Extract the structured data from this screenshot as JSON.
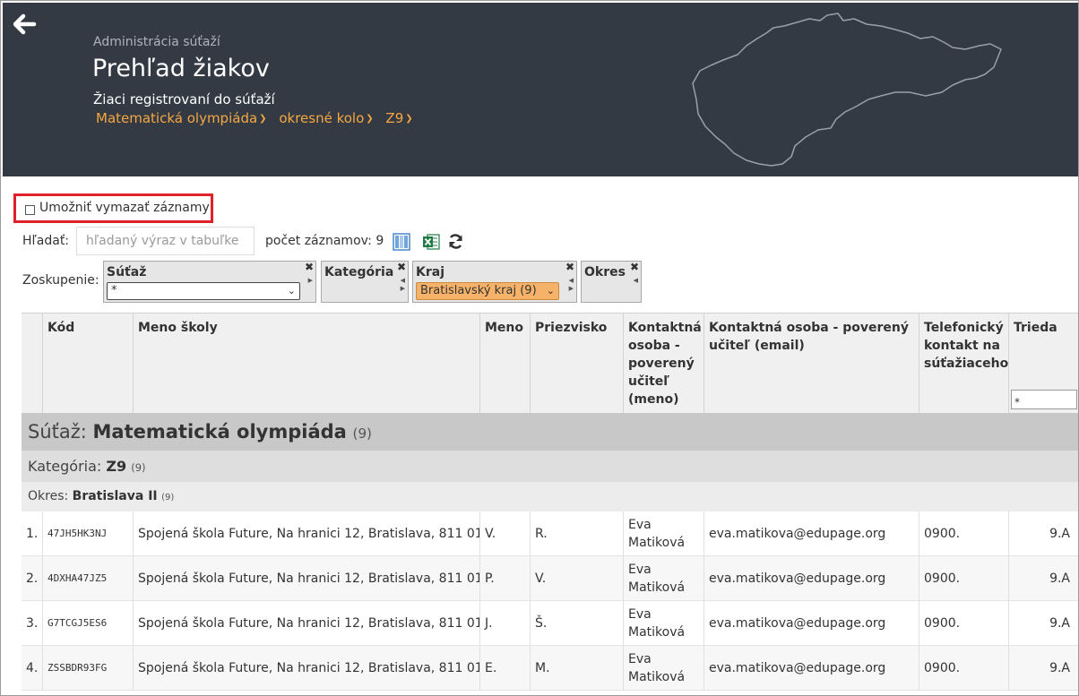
{
  "header": {
    "subtitle": "Administrácia súťaží",
    "title": "Prehľad žiakov",
    "description": "Žiaci registrovaní do súťaží",
    "breadcrumbs": [
      "Matematická olympiáda",
      "okresné kolo",
      "Z9"
    ]
  },
  "toolbar": {
    "delete_label": "Umožniť vymazať záznamy",
    "search_label": "Hľadať:",
    "search_placeholder": "hľadaný výraz v tabuľke",
    "count_text": "počet záznamov: 9"
  },
  "grouping": {
    "label": "Zoskupenie:",
    "boxes": [
      {
        "name": "Súťaž",
        "value": "*"
      },
      {
        "name": "Kategória",
        "value": ""
      },
      {
        "name": "Kraj",
        "value": "Bratislavský kraj (9)"
      },
      {
        "name": "Okres",
        "value": ""
      }
    ]
  },
  "table": {
    "columns": [
      "",
      "Kód",
      "Meno školy",
      "Meno",
      "Priezvisko",
      "Kontaktná osoba - poverený učiteľ (meno)",
      "Kontaktná osoba - poverený učiteľ (email)",
      "Telefonický kontakt na súťažiaceho",
      "Trieda"
    ],
    "class_filter": "*",
    "group1": {
      "label": "Súťaž: ",
      "value": "Matematická olympiáda",
      "count": "(9)"
    },
    "group2": {
      "label": "Kategória: ",
      "value": "Z9",
      "count": "(9)"
    },
    "group3": {
      "label": "Okres: ",
      "value": "Bratislava II",
      "count": "(9)"
    },
    "rows": [
      {
        "num": "1.",
        "code": "47JH5HK3NJ",
        "school": "Spojená škola Future, Na hranici 12, Bratislava, 811 01",
        "first": "V.",
        "last": "R.",
        "contact": "Eva Matiková",
        "email": "eva.matikova@edupage.org",
        "phone": "0900.",
        "class": "9.A"
      },
      {
        "num": "2.",
        "code": "4DXHA47JZ5",
        "school": "Spojená škola Future, Na hranici 12, Bratislava, 811 01",
        "first": "P.",
        "last": "V.",
        "contact": "Eva Matiková",
        "email": "eva.matikova@edupage.org",
        "phone": "0900.",
        "class": "9.A"
      },
      {
        "num": "3.",
        "code": "G7TCGJ5ES6",
        "school": "Spojená škola Future, Na hranici 12, Bratislava, 811 01",
        "first": "J.",
        "last": "Š.",
        "contact": "Eva Matiková",
        "email": "eva.matikova@edupage.org",
        "phone": "0900.",
        "class": "9.A"
      },
      {
        "num": "4.",
        "code": "ZSSBDR93FG",
        "school": "Spojená škola Future, Na hranici 12, Bratislava, 811 01",
        "first": "E.",
        "last": "M.",
        "contact": "Eva Matiková",
        "email": "eva.matikova@edupage.org",
        "phone": "0900.",
        "class": "9.A"
      }
    ]
  }
}
